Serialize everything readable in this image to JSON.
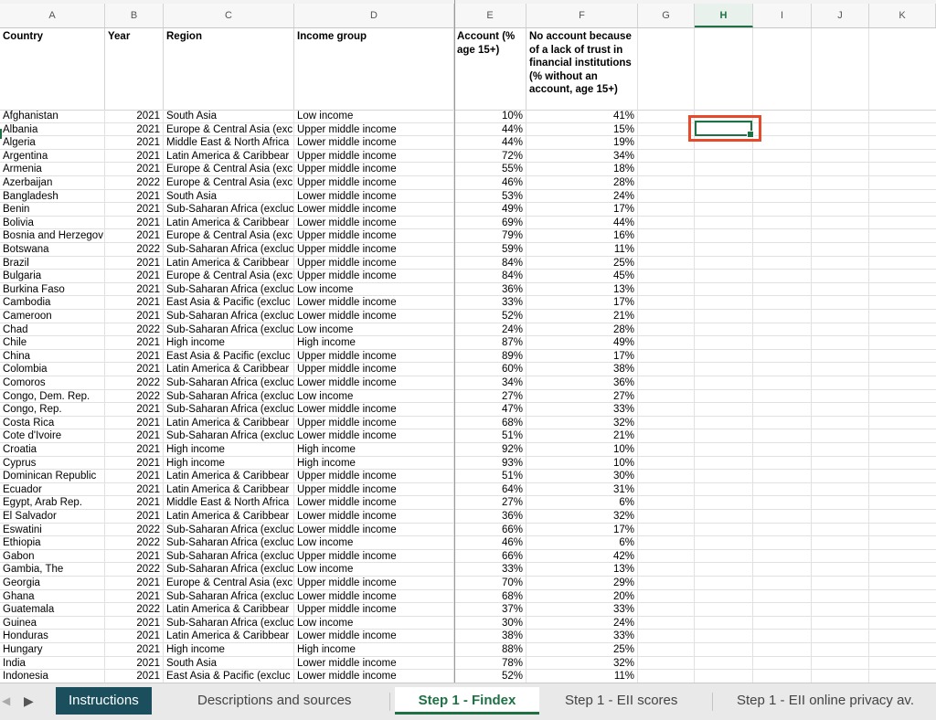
{
  "columns": [
    "A",
    "B",
    "C",
    "D",
    "E",
    "F",
    "G",
    "H",
    "I",
    "J",
    "K"
  ],
  "headers": {
    "country": "Country",
    "year": "Year",
    "region": "Region",
    "income_group": "Income group",
    "account": "Account (% age 15+)",
    "no_account_trust": "No account because of a lack of trust in financial institutions (% without an account, age 15+)"
  },
  "rows": [
    [
      "Afghanistan",
      "2021",
      "South Asia",
      "Low income",
      "10%",
      "41%"
    ],
    [
      "Albania",
      "2021",
      "Europe & Central Asia (exc",
      "Upper middle income",
      "44%",
      "15%"
    ],
    [
      "Algeria",
      "2021",
      "Middle East & North Africa",
      "Lower middle income",
      "44%",
      "19%"
    ],
    [
      "Argentina",
      "2021",
      "Latin America & Caribbear",
      "Upper middle income",
      "72%",
      "34%"
    ],
    [
      "Armenia",
      "2021",
      "Europe & Central Asia (exc",
      "Upper middle income",
      "55%",
      "18%"
    ],
    [
      "Azerbaijan",
      "2022",
      "Europe & Central Asia (exc",
      "Upper middle income",
      "46%",
      "28%"
    ],
    [
      "Bangladesh",
      "2021",
      "South Asia",
      "Lower middle income",
      "53%",
      "24%"
    ],
    [
      "Benin",
      "2021",
      "Sub-Saharan Africa (excluc",
      "Lower middle income",
      "49%",
      "17%"
    ],
    [
      "Bolivia",
      "2021",
      "Latin America & Caribbear",
      "Lower middle income",
      "69%",
      "44%"
    ],
    [
      "Bosnia and Herzegov",
      "2021",
      "Europe & Central Asia (exc",
      "Upper middle income",
      "79%",
      "16%"
    ],
    [
      "Botswana",
      "2022",
      "Sub-Saharan Africa (excluc",
      "Upper middle income",
      "59%",
      "11%"
    ],
    [
      "Brazil",
      "2021",
      "Latin America & Caribbear",
      "Upper middle income",
      "84%",
      "25%"
    ],
    [
      "Bulgaria",
      "2021",
      "Europe & Central Asia (exc",
      "Upper middle income",
      "84%",
      "45%"
    ],
    [
      "Burkina Faso",
      "2021",
      "Sub-Saharan Africa (excluc",
      "Low income",
      "36%",
      "13%"
    ],
    [
      "Cambodia",
      "2021",
      "East Asia & Pacific (excluc",
      "Lower middle income",
      "33%",
      "17%"
    ],
    [
      "Cameroon",
      "2021",
      "Sub-Saharan Africa (excluc",
      "Lower middle income",
      "52%",
      "21%"
    ],
    [
      "Chad",
      "2022",
      "Sub-Saharan Africa (excluc",
      "Low income",
      "24%",
      "28%"
    ],
    [
      "Chile",
      "2021",
      "High income",
      "High income",
      "87%",
      "49%"
    ],
    [
      "China",
      "2021",
      "East Asia & Pacific (excluc",
      "Upper middle income",
      "89%",
      "17%"
    ],
    [
      "Colombia",
      "2021",
      "Latin America & Caribbear",
      "Upper middle income",
      "60%",
      "38%"
    ],
    [
      "Comoros",
      "2022",
      "Sub-Saharan Africa (excluc",
      "Lower middle income",
      "34%",
      "36%"
    ],
    [
      "Congo, Dem. Rep.",
      "2022",
      "Sub-Saharan Africa (excluc",
      "Low income",
      "27%",
      "27%"
    ],
    [
      "Congo, Rep.",
      "2021",
      "Sub-Saharan Africa (excluc",
      "Lower middle income",
      "47%",
      "33%"
    ],
    [
      "Costa Rica",
      "2021",
      "Latin America & Caribbear",
      "Upper middle income",
      "68%",
      "32%"
    ],
    [
      "Cote d'Ivoire",
      "2021",
      "Sub-Saharan Africa (excluc",
      "Lower middle income",
      "51%",
      "21%"
    ],
    [
      "Croatia",
      "2021",
      "High income",
      "High income",
      "92%",
      "10%"
    ],
    [
      "Cyprus",
      "2021",
      "High income",
      "High income",
      "93%",
      "10%"
    ],
    [
      "Dominican Republic",
      "2021",
      "Latin America & Caribbear",
      "Upper middle income",
      "51%",
      "30%"
    ],
    [
      "Ecuador",
      "2021",
      "Latin America & Caribbear",
      "Upper middle income",
      "64%",
      "31%"
    ],
    [
      "Egypt, Arab Rep.",
      "2021",
      "Middle East & North Africa",
      "Lower middle income",
      "27%",
      "6%"
    ],
    [
      "El Salvador",
      "2021",
      "Latin America & Caribbear",
      "Lower middle income",
      "36%",
      "32%"
    ],
    [
      "Eswatini",
      "2022",
      "Sub-Saharan Africa (excluc",
      "Lower middle income",
      "66%",
      "17%"
    ],
    [
      "Ethiopia",
      "2022",
      "Sub-Saharan Africa (excluc",
      "Low income",
      "46%",
      "6%"
    ],
    [
      "Gabon",
      "2021",
      "Sub-Saharan Africa (excluc",
      "Upper middle income",
      "66%",
      "42%"
    ],
    [
      "Gambia, The",
      "2022",
      "Sub-Saharan Africa (excluc",
      "Low income",
      "33%",
      "13%"
    ],
    [
      "Georgia",
      "2021",
      "Europe & Central Asia (exc",
      "Upper middle income",
      "70%",
      "29%"
    ],
    [
      "Ghana",
      "2021",
      "Sub-Saharan Africa (excluc",
      "Lower middle income",
      "68%",
      "20%"
    ],
    [
      "Guatemala",
      "2022",
      "Latin America & Caribbear",
      "Upper middle income",
      "37%",
      "33%"
    ],
    [
      "Guinea",
      "2021",
      "Sub-Saharan Africa (excluc",
      "Low income",
      "30%",
      "24%"
    ],
    [
      "Honduras",
      "2021",
      "Latin America & Caribbear",
      "Lower middle income",
      "38%",
      "33%"
    ],
    [
      "Hungary",
      "2021",
      "High income",
      "High income",
      "88%",
      "25%"
    ],
    [
      "India",
      "2021",
      "South Asia",
      "Lower middle income",
      "78%",
      "32%"
    ],
    [
      "Indonesia",
      "2021",
      "East Asia & Pacific (excluc",
      "Lower middle income",
      "52%",
      "11%"
    ]
  ],
  "selected_column": "H",
  "tabs": {
    "instructions": "Instructions",
    "descriptions": "Descriptions and sources",
    "step1_findex": "Step 1 - Findex",
    "step1_eii_scores": "Step 1 - EII scores",
    "step1_eii_privacy": "Step 1 - EII online privacy av."
  },
  "nav_icons": [
    "scroll-left-icon",
    "scroll-right-icon"
  ],
  "colors": {
    "accent": "#1e7145",
    "instructions_tab": "#1b4f5d",
    "highlight": "#e8492a"
  }
}
